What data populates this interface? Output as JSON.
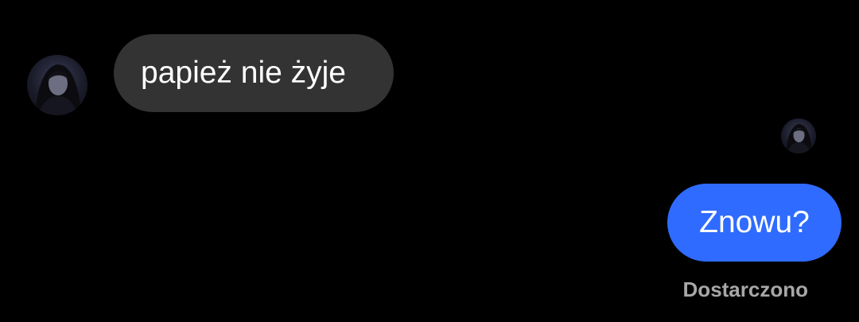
{
  "conversation": {
    "messages": [
      {
        "direction": "incoming",
        "text": "papież nie żyje"
      },
      {
        "direction": "outgoing",
        "text": "Znowu?"
      }
    ],
    "status_text": "Dostarczono"
  },
  "colors": {
    "background": "#000000",
    "incoming_bubble": "#333333",
    "outgoing_bubble": "#2f6bff",
    "message_text": "#ffffff",
    "status_text": "#a7a7a7"
  },
  "icons": {
    "contact_avatar": "contact-avatar-photo",
    "read_avatar": "read-receipt-avatar-photo"
  }
}
